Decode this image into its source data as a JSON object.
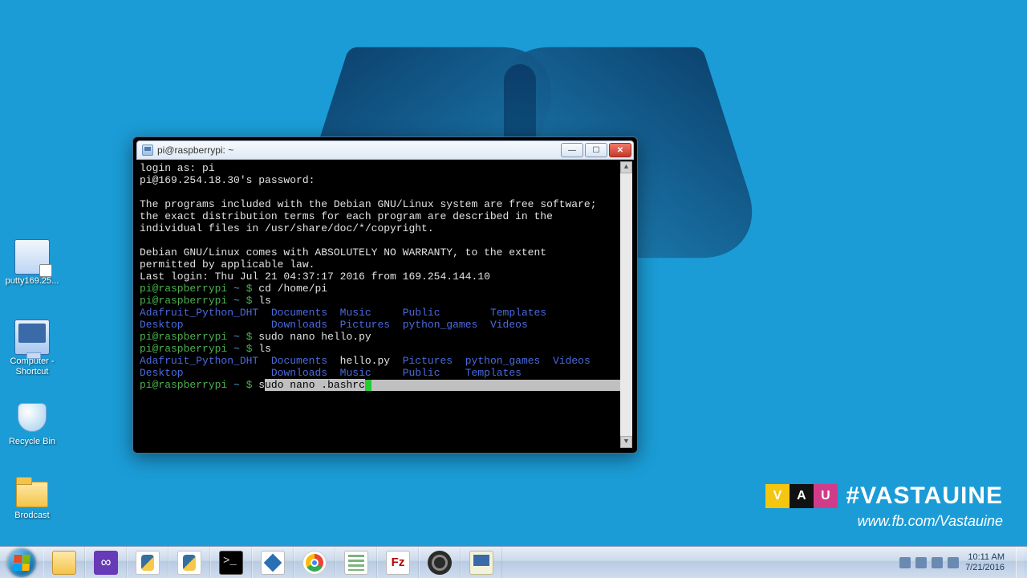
{
  "desktop": {
    "icons": [
      {
        "name": "putty169.25..."
      },
      {
        "name": "Computer - Shortcut"
      },
      {
        "name": "Recycle Bin"
      },
      {
        "name": "Brodcast"
      }
    ]
  },
  "watermark": {
    "logo_letters": [
      "V",
      "A",
      "U"
    ],
    "logo_colors": [
      "#f4c60f",
      "#111111",
      "#d13c8a"
    ],
    "hashtag": "#VASTAUINE",
    "url": "www.fb.com/Vastauine"
  },
  "window": {
    "title": "pi@raspberrypi: ~"
  },
  "terminal": {
    "login_prompt": "login as: pi",
    "password_prompt": "pi@169.254.18.30's password:",
    "motd": [
      "The programs included with the Debian GNU/Linux system are free software;",
      "the exact distribution terms for each program are described in the",
      "individual files in /usr/share/doc/*/copyright."
    ],
    "warranty": [
      "Debian GNU/Linux comes with ABSOLUTELY NO WARRANTY, to the extent",
      "permitted by applicable law."
    ],
    "last_login": "Last login: Thu Jul 21 04:37:17 2016 from 169.254.144.10",
    "prompt_user": "pi@raspberrypi",
    "prompt_path": "~",
    "prompt_sep": "$",
    "cmds": {
      "cd": "cd /home/pi",
      "ls1": "ls",
      "nano1": "sudo nano hello.py",
      "ls2": "ls",
      "current_pre": "s",
      "current_sel": "udo nano .bashrc"
    },
    "ls_out1": {
      "row1": [
        "Adafruit_Python_DHT",
        "Documents",
        "Music   ",
        "Public      ",
        "Templates"
      ],
      "row2": [
        "Desktop            ",
        "Downloads",
        "Pictures",
        "python_games",
        "Videos"
      ]
    },
    "ls_out2": {
      "row1": [
        "Adafruit_Python_DHT",
        "Documents",
        "hello.py",
        "Pictures",
        "python_games",
        "Videos"
      ],
      "row2": [
        "Desktop            ",
        "Downloads",
        "Music   ",
        "Public  ",
        "Templates"
      ]
    }
  },
  "taskbar": {
    "pins": [
      "explorer",
      "vs",
      "py1",
      "py2",
      "cmd",
      "tool",
      "chrome",
      "sheet",
      "fz",
      "obs",
      "putty"
    ]
  },
  "tray": {
    "time": "10:11 AM",
    "date": "7/21/2016"
  }
}
